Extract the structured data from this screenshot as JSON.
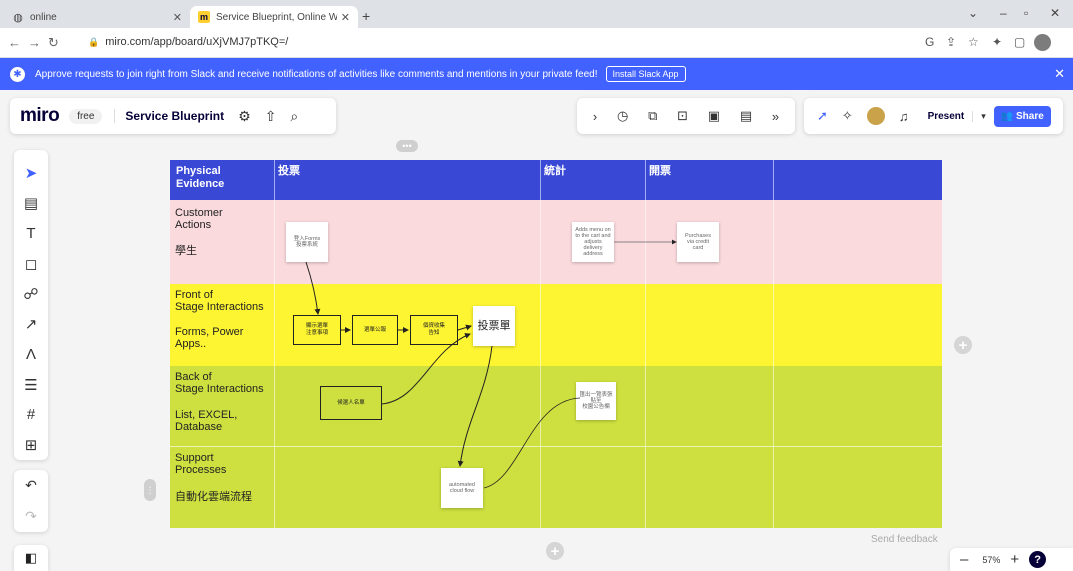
{
  "browser": {
    "tabs": [
      {
        "label": "online",
        "active": false
      },
      {
        "label": "Service Blueprint, Online White",
        "active": true
      }
    ],
    "url": "miro.com/app/board/uXjVMJ7pTKQ=/"
  },
  "banner": {
    "text": "Approve requests to join right from Slack and receive notifications of activities like comments and mentions in your private feed!",
    "button": "Install Slack App"
  },
  "toolbar": {
    "logo": "miro",
    "plan": "free",
    "board_name": "Service Blueprint",
    "present": "Present",
    "share": "Share"
  },
  "board": {
    "headers": [
      "Physical\nEvidence",
      "投票",
      "統計",
      "開票"
    ],
    "lanes": [
      {
        "title": "Customer\nActions",
        "sub": "學生"
      },
      {
        "title": "Front of\nStage Interactions",
        "sub": "Forms, Power\nApps.."
      },
      {
        "title": "Back of\nStage Interactions",
        "sub": "List, EXCEL,\nDatabase"
      },
      {
        "title": "Support\nProcesses",
        "sub": "自動化雲端流程"
      }
    ],
    "notes": {
      "login": "登入Forms\n投票系統",
      "add_menu": "Adds menu on\nto the cart and\nadjusts\ndelivery\naddress",
      "purchases": "Purchases\nvia credit\ncard",
      "ballot": "投票單",
      "unknown_note": "匯出一覽表張貼至\n校園公告欄",
      "automated": "automated\ncloud flow"
    },
    "boxes": {
      "show_ballot": "顯示選單\n注意事項",
      "ballot_notice": "選單公報",
      "collect": "個資收集\n告知",
      "candidates": "候選人名單"
    },
    "row_colors": {
      "header": "#3949d6",
      "customer": "#fadadd",
      "front": "#fdf531",
      "back": "#cde03f"
    }
  },
  "footer": {
    "feedback": "Send feedback",
    "zoom": "57%"
  }
}
